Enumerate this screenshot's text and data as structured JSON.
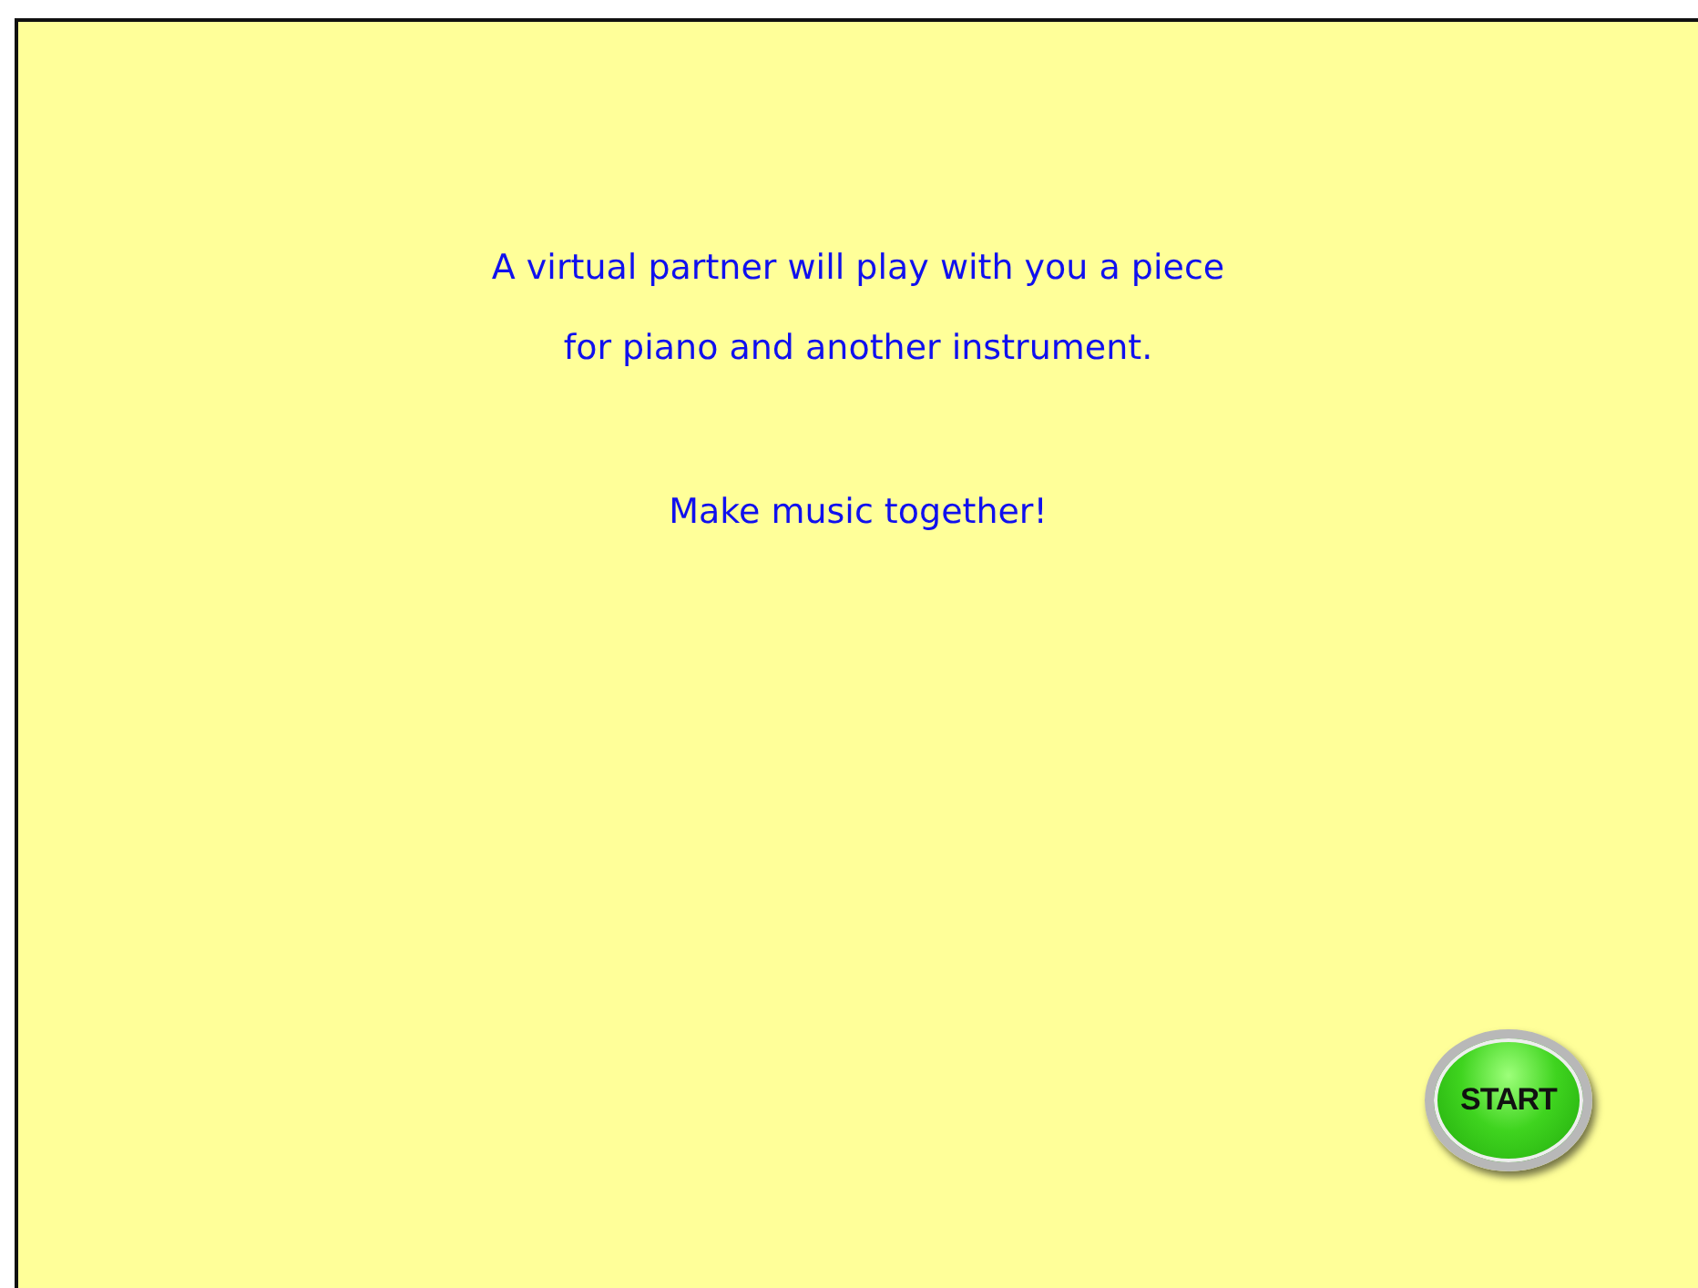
{
  "intro": {
    "lines": [
      "A virtual partner will play with you a piece",
      "for piano and another instrument."
    ],
    "slogan": "Make music together!"
  },
  "start_button": {
    "label": "START"
  }
}
